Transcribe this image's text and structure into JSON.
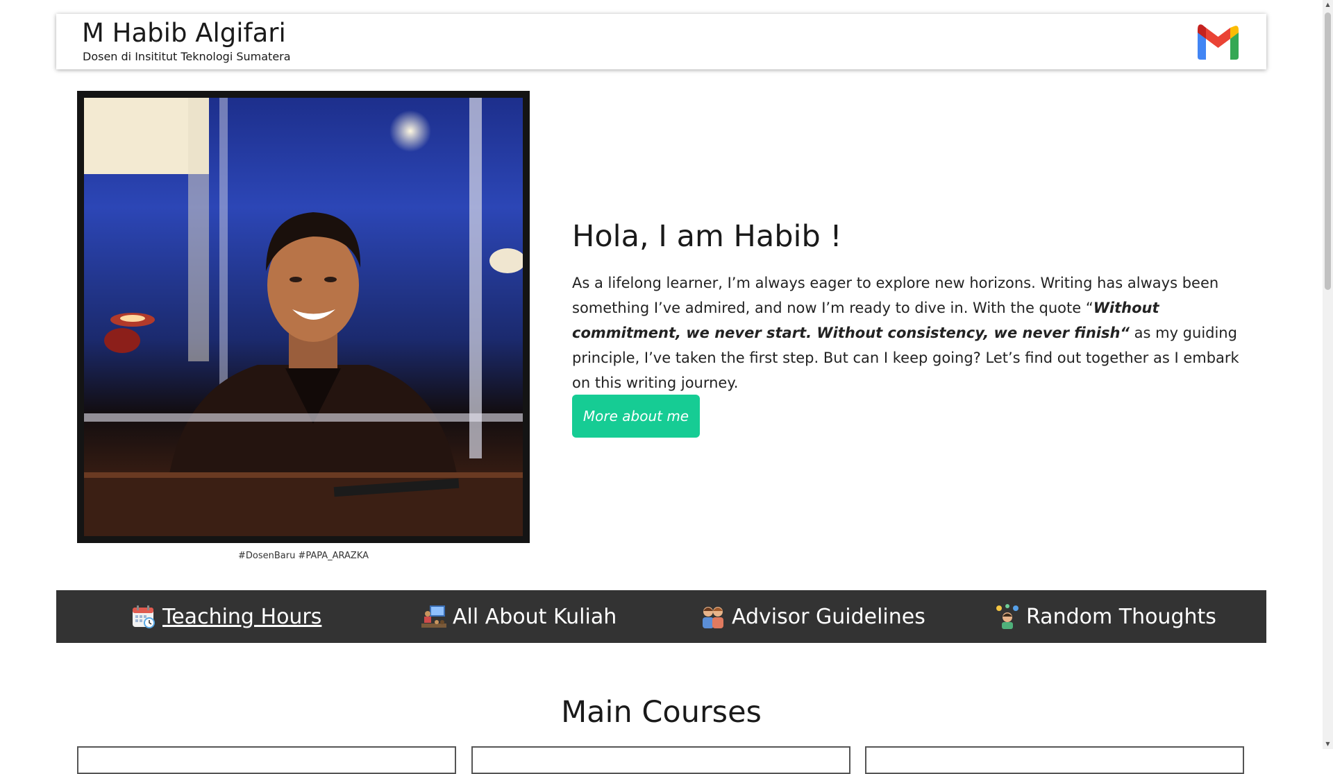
{
  "header": {
    "title": "M Habib Algifari",
    "tagline": "Dosen di Insititut Teknologi Sumatera",
    "mail_icon": "gmail-icon"
  },
  "hero": {
    "photo_caption": "#DosenBaru #PAPA_ARAZKA",
    "heading": "Hola, I am Habib !",
    "text_1": "As a lifelong learner, I’m always eager to explore new horizons. Writing has always been something I’ve admired, and now I’m ready to dive in. With the quote “",
    "quote": "Without commitment, we never start. Without consistency, we never finish“",
    "text_2": " as my guiding principle, I’ve taken the first step. But can I keep going? Let’s find out together as I embark on this writing journey.",
    "button_label": "More about me",
    "button_color": "#16cc94"
  },
  "nav": {
    "background": "#333333",
    "items": [
      {
        "label": "Teaching Hours",
        "icon": "calendar-clock-icon",
        "active": true
      },
      {
        "label": "All About Kuliah",
        "icon": "presentation-icon",
        "active": false
      },
      {
        "label": "Advisor Guidelines",
        "icon": "people-icon",
        "active": false
      },
      {
        "label": "Random Thoughts",
        "icon": "thinking-person-icon",
        "active": false
      }
    ]
  },
  "main": {
    "section_title": "Main Courses"
  }
}
